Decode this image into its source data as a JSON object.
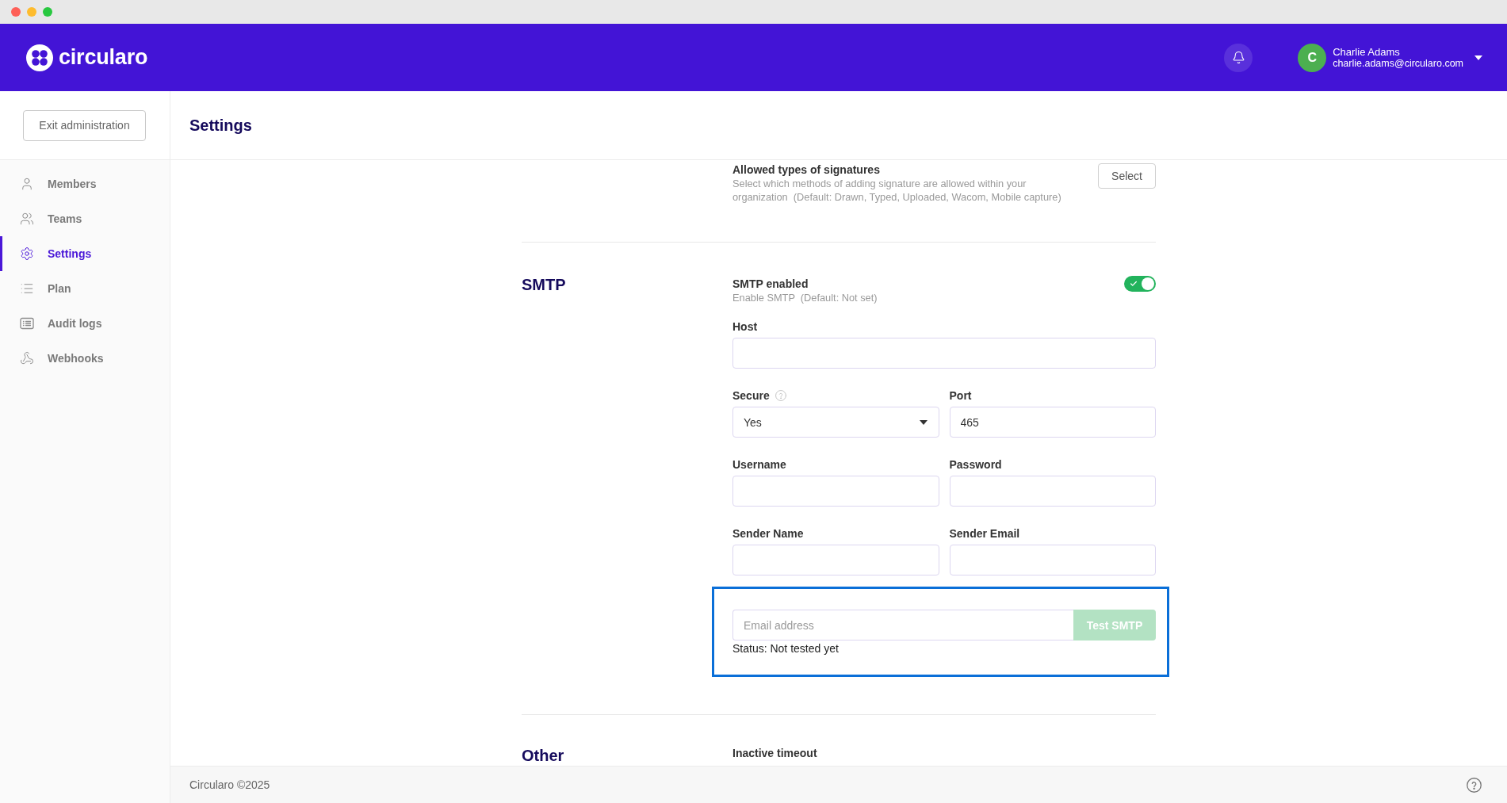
{
  "header": {
    "logo_text": "circularo",
    "user": {
      "initial": "C",
      "name": "Charlie Adams",
      "email": "charlie.adams@circularo.com"
    }
  },
  "sidebar": {
    "exit_button": "Exit administration",
    "items": [
      {
        "label": "Members",
        "selected": false
      },
      {
        "label": "Teams",
        "selected": false
      },
      {
        "label": "Settings",
        "selected": true
      },
      {
        "label": "Plan",
        "selected": false
      },
      {
        "label": "Audit logs",
        "selected": false
      },
      {
        "label": "Webhooks",
        "selected": false
      }
    ]
  },
  "page": {
    "title": "Settings"
  },
  "sections": [
    {
      "fields": [
        {
          "kind": "action",
          "label": "Allowed types of signatures",
          "description": "Select which methods of adding signature are allowed within your organization  (Default: Drawn, Typed, Uploaded, Wacom, Mobile capture)",
          "button": "Select"
        }
      ]
    },
    {
      "title": "SMTP",
      "fields": [
        {
          "kind": "toggle",
          "label": "SMTP enabled",
          "description": "Enable SMTP  (Default: Not set)",
          "on": true
        },
        {
          "kind": "text",
          "label": "Host",
          "help": false
        },
        {
          "kind": "pair",
          "items": [
            {
              "kind": "select",
              "label": "Secure",
              "help": true,
              "value": "Yes"
            },
            {
              "kind": "text",
              "label": "Port",
              "help": false,
              "value": "465"
            }
          ]
        },
        {
          "kind": "pair",
          "items": [
            {
              "kind": "text",
              "label": "Username",
              "help": false
            },
            {
              "kind": "text",
              "label": "Password",
              "help": false
            }
          ]
        },
        {
          "kind": "pair",
          "items": [
            {
              "kind": "text",
              "label": "Sender Name",
              "help": false
            },
            {
              "kind": "text",
              "label": "Sender Email",
              "help": false
            }
          ]
        },
        {
          "kind": "test",
          "placeholder": "Email address",
          "button": "Test SMTP",
          "disabled": true,
          "status": "Status: Not tested yet",
          "highlighted": true
        }
      ]
    },
    {
      "title": "Other",
      "fields": [
        {
          "kind": "heading",
          "label": "Inactive timeout"
        }
      ]
    }
  ],
  "footer": {
    "text": "Circularo ©2025"
  }
}
